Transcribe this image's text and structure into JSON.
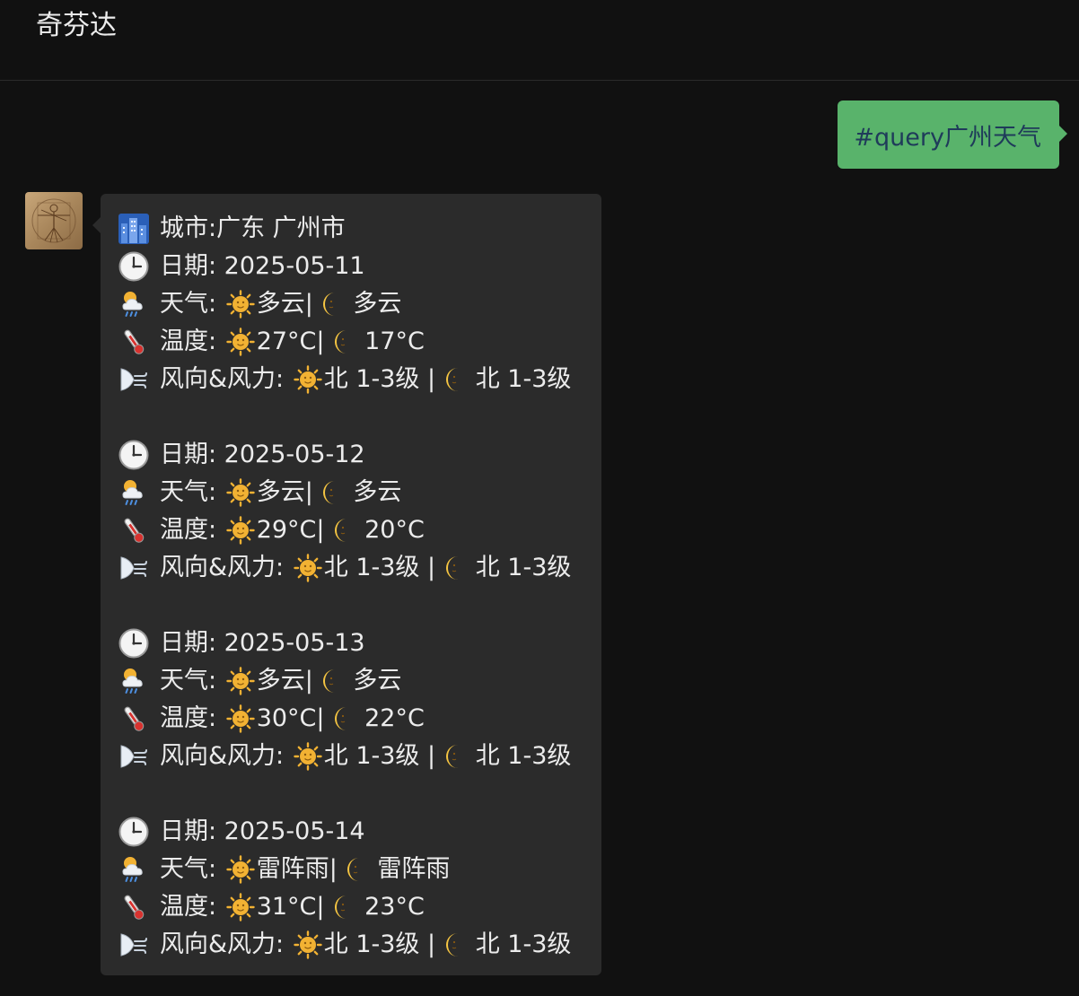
{
  "chat": {
    "title": "奇芬达"
  },
  "sent_message": {
    "text": "#query广州天气",
    "color": "#59b36b"
  },
  "received_message": {
    "city_label": "城市:广东 广州市",
    "days": [
      {
        "date_label": "日期: 2025-05-11",
        "weather_label": "天气:",
        "weather_day": "多云|",
        "weather_night": "多云",
        "temp_label": "温度:",
        "temp_day": "27°C|",
        "temp_night": "17°C",
        "wind_label": "风向&风力:",
        "wind_day": "北 1-3级 |",
        "wind_night": "北 1-3级"
      },
      {
        "date_label": "日期: 2025-05-12",
        "weather_label": "天气:",
        "weather_day": "多云|",
        "weather_night": "多云",
        "temp_label": "温度:",
        "temp_day": "29°C|",
        "temp_night": "20°C",
        "wind_label": "风向&风力:",
        "wind_day": "北 1-3级 |",
        "wind_night": "北 1-3级"
      },
      {
        "date_label": "日期: 2025-05-13",
        "weather_label": "天气:",
        "weather_day": "多云|",
        "weather_night": "多云",
        "temp_label": "温度:",
        "temp_day": "30°C|",
        "temp_night": "22°C",
        "wind_label": "风向&风力:",
        "wind_day": "北 1-3级 |",
        "wind_night": "北 1-3级"
      },
      {
        "date_label": "日期: 2025-05-14",
        "weather_label": "天气:",
        "weather_day": "雷阵雨|",
        "weather_night": "雷阵雨",
        "temp_label": "温度:",
        "temp_day": "31°C|",
        "temp_night": "23°C",
        "wind_label": "风向&风力:",
        "wind_day": "北 1-3级 |",
        "wind_night": "北 1-3级"
      }
    ],
    "icons": {
      "city": "cityscape-icon",
      "date": "clock-icon",
      "weather": "sun-behind-rain-cloud-icon",
      "temperature": "thermometer-icon",
      "wind": "wind-face-icon",
      "day": "sun-with-face-icon",
      "night": "crescent-moon-face-icon"
    }
  }
}
